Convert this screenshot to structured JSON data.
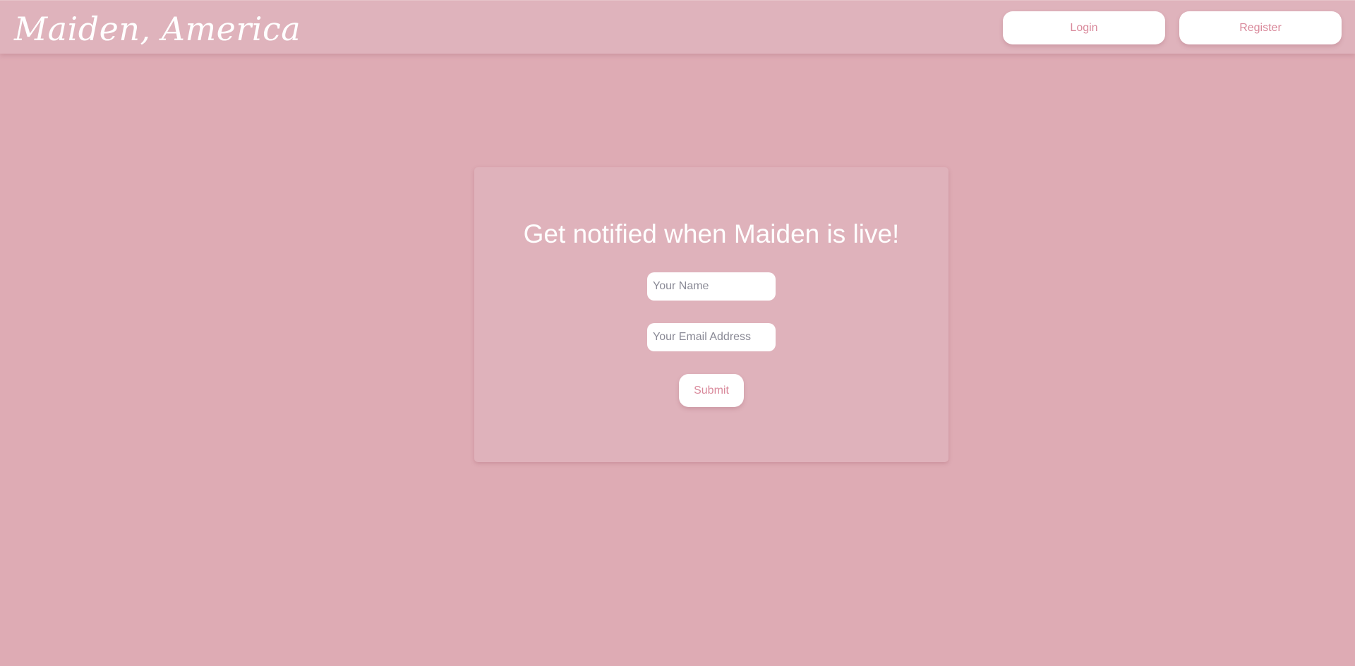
{
  "header": {
    "brand": "Maiden, America",
    "login_label": "Login",
    "register_label": "Register"
  },
  "signup": {
    "title": "Get notified when Maiden is live!",
    "name_placeholder": "Your Name",
    "name_value": "",
    "email_placeholder": "Your Email Address",
    "email_value": "",
    "submit_label": "Submit"
  },
  "colors": {
    "background": "#deabb4",
    "header": "#dfb3bc",
    "card": "#dfb2bb",
    "button_text": "#d9899b",
    "white": "#ffffff"
  }
}
